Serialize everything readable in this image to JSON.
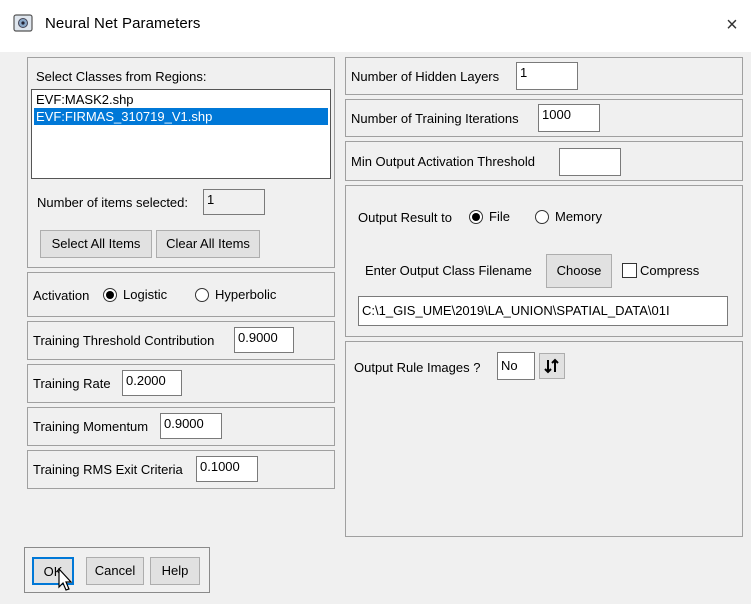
{
  "window": {
    "title": "Neural Net Parameters",
    "close_glyph": "×",
    "icon": "app-window-icon"
  },
  "classes": {
    "label": "Select Classes from Regions:",
    "items": [
      {
        "label": "EVF:MASK2.shp",
        "selected": false
      },
      {
        "label": "EVF:FIRMAS_310719_V1.shp",
        "selected": true
      }
    ],
    "count_label": "Number of items selected:",
    "count_value": "1",
    "select_all_label": "Select All Items",
    "clear_all_label": "Clear All Items"
  },
  "activation": {
    "label": "Activation",
    "options": [
      {
        "label": "Logistic",
        "selected": true
      },
      {
        "label": "Hyperbolic",
        "selected": false
      }
    ]
  },
  "training": {
    "threshold_label": "Training Threshold Contribution",
    "threshold_value": "0.9000",
    "rate_label": "Training Rate",
    "rate_value": "0.2000",
    "momentum_label": "Training Momentum",
    "momentum_value": "0.9000",
    "rms_label": "Training RMS Exit Criteria",
    "rms_value": "0.1000"
  },
  "network": {
    "hidden_layers_label": "Number of Hidden Layers",
    "hidden_layers_value": "1",
    "iterations_label": "Number of Training Iterations",
    "iterations_value": "1000",
    "min_activation_label": "Min Output Activation Threshold",
    "min_activation_value": ""
  },
  "output": {
    "result_label": "Output Result to",
    "options": [
      {
        "label": "File",
        "selected": true
      },
      {
        "label": "Memory",
        "selected": false
      }
    ],
    "filename_label": "Enter Output Class Filename",
    "choose_label": "Choose",
    "compress_label": "Compress",
    "compress_checked": false,
    "path_value": "C:\\1_GIS_UME\\2019\\LA_UNION\\SPATIAL_DATA\\01I"
  },
  "rule_images": {
    "label": "Output Rule Images ?",
    "value": "No",
    "toggle_icon": "swap-vertical-icon"
  },
  "buttons": {
    "ok_label": "OK",
    "cancel_label": "Cancel",
    "help_label": "Help"
  }
}
